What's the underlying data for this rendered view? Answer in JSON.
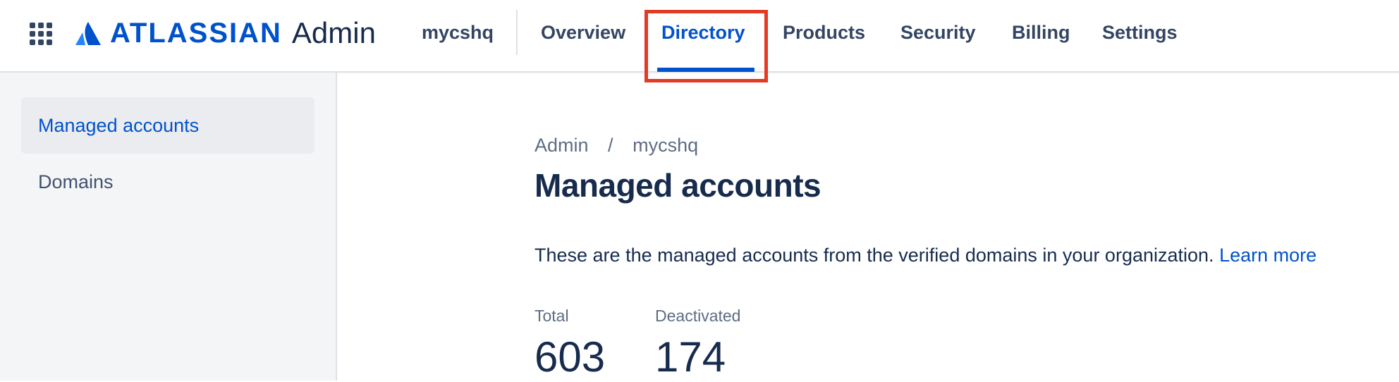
{
  "header": {
    "app_switcher_icon": "app-switcher-grid-icon",
    "logo_icon": "atlassian-logo-icon",
    "logo_text": "ATLASSIAN",
    "product_name": "Admin",
    "org_name": "mycshq",
    "brand_color": "#0052CC",
    "tabs": [
      {
        "label": "Overview",
        "active": false
      },
      {
        "label": "Directory",
        "active": true
      },
      {
        "label": "Products",
        "active": false
      },
      {
        "label": "Security",
        "active": false
      },
      {
        "label": "Billing",
        "active": false
      },
      {
        "label": "Settings",
        "active": false
      }
    ],
    "highlight_color": "#E33A24"
  },
  "sidebar": {
    "items": [
      {
        "label": "Managed accounts",
        "selected": true
      },
      {
        "label": "Domains",
        "selected": false
      }
    ]
  },
  "main": {
    "breadcrumb": {
      "items": [
        "Admin",
        "mycshq"
      ],
      "separator": "/"
    },
    "title": "Managed accounts",
    "description": "These are the managed accounts from the verified domains in your organization.",
    "learn_more": "Learn more",
    "stats": [
      {
        "label": "Total",
        "value": "603"
      },
      {
        "label": "Deactivated",
        "value": "174"
      }
    ]
  }
}
